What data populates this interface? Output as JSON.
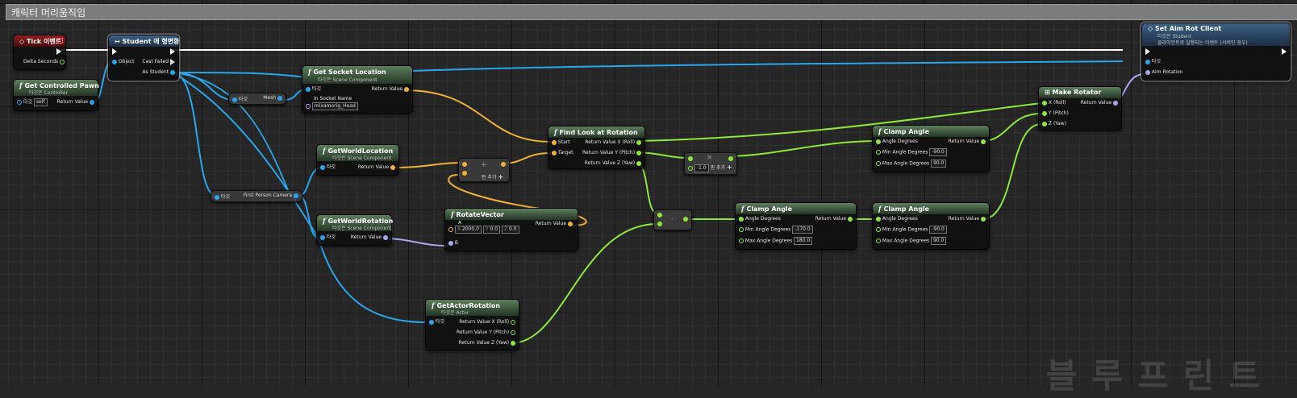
{
  "graph": {
    "title": "캐릭터 머리움직임",
    "watermark": "블루프린트"
  },
  "nodes": {
    "tick": {
      "title": "Tick 이벤트",
      "delta": "Delta Seconds"
    },
    "cast": {
      "title": "Student 에 형변환",
      "object": "Object",
      "cast_failed": "Cast Failed",
      "as_student": "As Student"
    },
    "pawn": {
      "title": "Get Controlled Pawn",
      "subtitle": "타깃은 Controller",
      "target": "타깃",
      "target_val": "self",
      "ret": "Return Value"
    },
    "mesh": {
      "target": "타깃",
      "out": "Mesh"
    },
    "socket": {
      "title": "Get Socket Location",
      "subtitle": "타깃은 Scene Component",
      "target": "타깃",
      "ret": "Return Value",
      "in_socket": "In Socket Name",
      "socket_val": "mixamorig_Head"
    },
    "fpc": {
      "target": "타깃",
      "out": "First Person Camera"
    },
    "worldloc": {
      "title": "GetWorldLocation",
      "subtitle": "타깃은 Scene Component",
      "target": "타깃",
      "ret": "Return Value"
    },
    "worldrot": {
      "title": "GetWorldRotation",
      "subtitle": "타깃은 Scene Component",
      "target": "타깃",
      "ret": "Return Value"
    },
    "add": {
      "op": "+",
      "add_pin": "핀 추가"
    },
    "rotvec": {
      "title": "RotateVector",
      "a": "A",
      "b": "B",
      "ret": "Return Value",
      "x_lbl": "X",
      "x": "2000.0",
      "y_lbl": "Y",
      "y": "0.0",
      "z_lbl": "Z",
      "z": "0.0"
    },
    "actorrot": {
      "title": "GetActorRotation",
      "subtitle": "타깃은 Actor",
      "target": "타깃",
      "rx": "Return Value X (Roll)",
      "ry": "Return Value Y (Pitch)",
      "rz": "Return Value Z (Yaw)"
    },
    "lookat": {
      "title": "Find Look at Rotation",
      "start": "Start",
      "target": "Target",
      "rx": "Return Value X (Roll)",
      "ry": "Return Value Y (Pitch)",
      "rz": "Return Value Z (Yaw)"
    },
    "mul": {
      "op": "×",
      "val": "-1.0",
      "add_pin": "핀 추가"
    },
    "sub": {
      "op": "-"
    },
    "clamp1": {
      "title": "Clamp Angle",
      "angle": "Angle Degrees",
      "min": "Min Angle Degrees",
      "min_val": "-90.0",
      "max": "Max Angle Degrees",
      "max_val": "90.0",
      "ret": "Return Value"
    },
    "clamp2": {
      "title": "Clamp Angle",
      "angle": "Angle Degrees",
      "min": "Min Angle Degrees",
      "min_val": "-170.0",
      "max": "Max Angle Degrees",
      "max_val": "180.0",
      "ret": "Return Value"
    },
    "clamp3": {
      "title": "Clamp Angle",
      "angle": "Angle Degrees",
      "min": "Min Angle Degrees",
      "min_val": "-90.0",
      "max": "Max Angle Degrees",
      "max_val": "90.0",
      "ret": "Return Value"
    },
    "makerot": {
      "title": "Make Rotator",
      "x": "X (Roll)",
      "y": "Y (Pitch)",
      "z": "Z (Yaw)",
      "ret": "Return Value"
    },
    "aim": {
      "title": "Set Aim Rot Client",
      "subtitle1": "타깃은 Student",
      "subtitle2": "클라이언트로 실행되는 이벤트 (서버인 경우)",
      "target": "타깃",
      "aim_rot": "Aim Rotation"
    }
  },
  "colors": {
    "exec": "#ffffff",
    "object": "#2aa6ec",
    "vector": "#f0b135",
    "float": "#8ee83b",
    "rotator": "#a6a8ee",
    "event_header": "#8f1f1f",
    "function_header": "#5c7f5c",
    "cast_header": "#3c6186"
  }
}
